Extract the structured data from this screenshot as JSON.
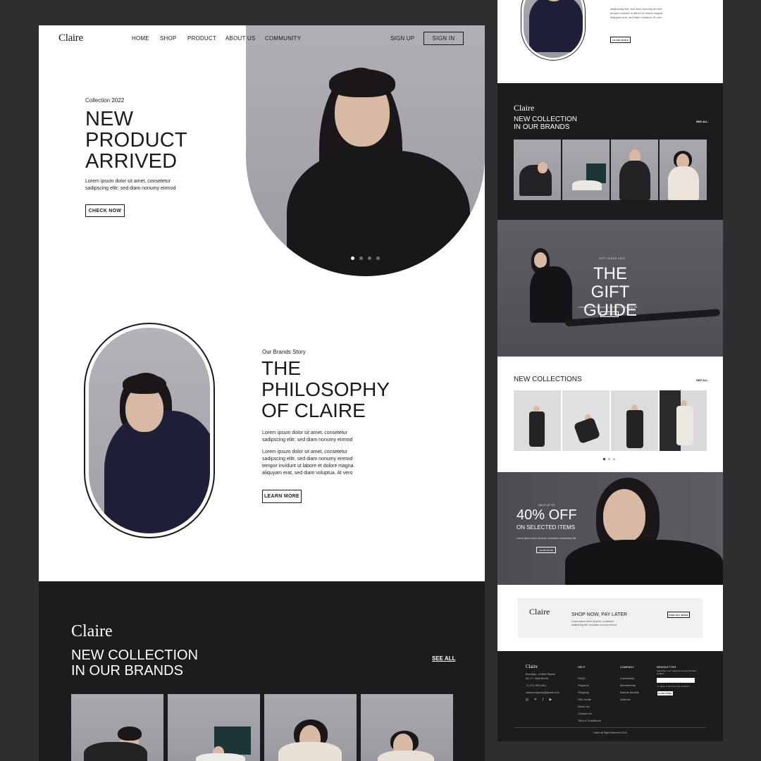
{
  "brand": "Claire",
  "nav": {
    "items": [
      "HOME",
      "SHOP",
      "PRODUCT",
      "ABOUT US",
      "COMMUNITY"
    ],
    "sign_up": "SIGN UP",
    "sign_in": "SIGN IN"
  },
  "hero": {
    "eyebrow": "Collection 2022",
    "title_l1": "NEW",
    "title_l2": "PRODUCT",
    "title_l3": "ARRIVED",
    "body_l1": "Lorem ipsum dolor sit amet, consetetur",
    "body_l2": "sadipscing elitr, sed diam nonumy eirmod",
    "cta": "CHECK NOW"
  },
  "story": {
    "eyebrow": "Our Brands Story",
    "title_l1": "THE",
    "title_l2": "PHILOSOPHY",
    "title_l3": "OF CLAIRE",
    "p1_l1": "Lorem ipsum dolor sit amet, consetetur",
    "p1_l2": "sadipscing elitr, sed diam nonumy eirmod",
    "p2_l1": "Lorem ipsum dolor sit amet, consetetur",
    "p2_l2": "sadipscing elitr, sed diam nonumy eirmod",
    "p2_l3": "tempor invidunt ut labore et dolore magna",
    "p2_l4": "aliquyam erat, sed diam voluptua. At vero",
    "cta": "LEARN MORE"
  },
  "collection": {
    "title_l1": "NEW COLLECTION",
    "title_l2": "IN OUR BRANDS",
    "see_all": "SEE ALL"
  },
  "right": {
    "top_body_l1": "sadipscing elitr, sed diam nonumy eirmod",
    "top_body_l2": "tempor invidunt ut labore et dolore magna",
    "top_body_l3": "aliquyam erat, sed diam voluptua. At vero",
    "top_cta": "LEARN MORE",
    "collection_l1": "NEW COLLECTION",
    "collection_l2": "IN OUR BRANDS",
    "see_all": "SEE ALL",
    "gift_eyebrow": "GIFT GUIDE 2022",
    "gift_l1": "THE GIFT",
    "gift_l2": "GUIDE",
    "gift_body": "Lorem ipsum dolor sit amet, consetetur sadipscing elitr",
    "gift_cta": "GET NOW",
    "new_collections": "NEW COLLECTIONS",
    "sale_eyebrow": "SALE UP TO",
    "sale_pct": "40% OFF",
    "sale_sub": "ON SELECTED ITEMS",
    "sale_body": "Lorem ipsum dolor sit amet, consetetur sadipscing elitr",
    "sale_cta": "LEARN MORE",
    "banner_title": "SHOP NOW, PAY LATER",
    "banner_body_l1": "Lorem ipsum dolor sit amet, consetetur",
    "banner_body_l2": "sadipscing elitr, sed diam nonumy eirmod",
    "banner_cta": "FIND OUT MORE",
    "footer": {
      "addr_l1": "Brooklyn, United States",
      "addr_l2": "No 27, Wall Street",
      "phone": "+1-212-000-444",
      "email": "clairecompany@gmail.com",
      "help_title": "HELP",
      "help_items": [
        "FAQS",
        "Payment",
        "Shipping",
        "Gift Center",
        "About Us",
        "Contact Us",
        "Term & Conditions"
      ],
      "company_title": "COMPANY",
      "company_items": [
        "Community",
        "Membership",
        "Brands Models",
        "Address"
      ],
      "newsletter_title": "NEWSLETTER",
      "newsletter_body": "Subscribe to our newsletter and get the latest updates",
      "newsletter_check": "I agree to the terms and conditions",
      "subscribe": "SUBSCRIBE",
      "copyright": "Claire All Right Reserved 2022"
    }
  }
}
